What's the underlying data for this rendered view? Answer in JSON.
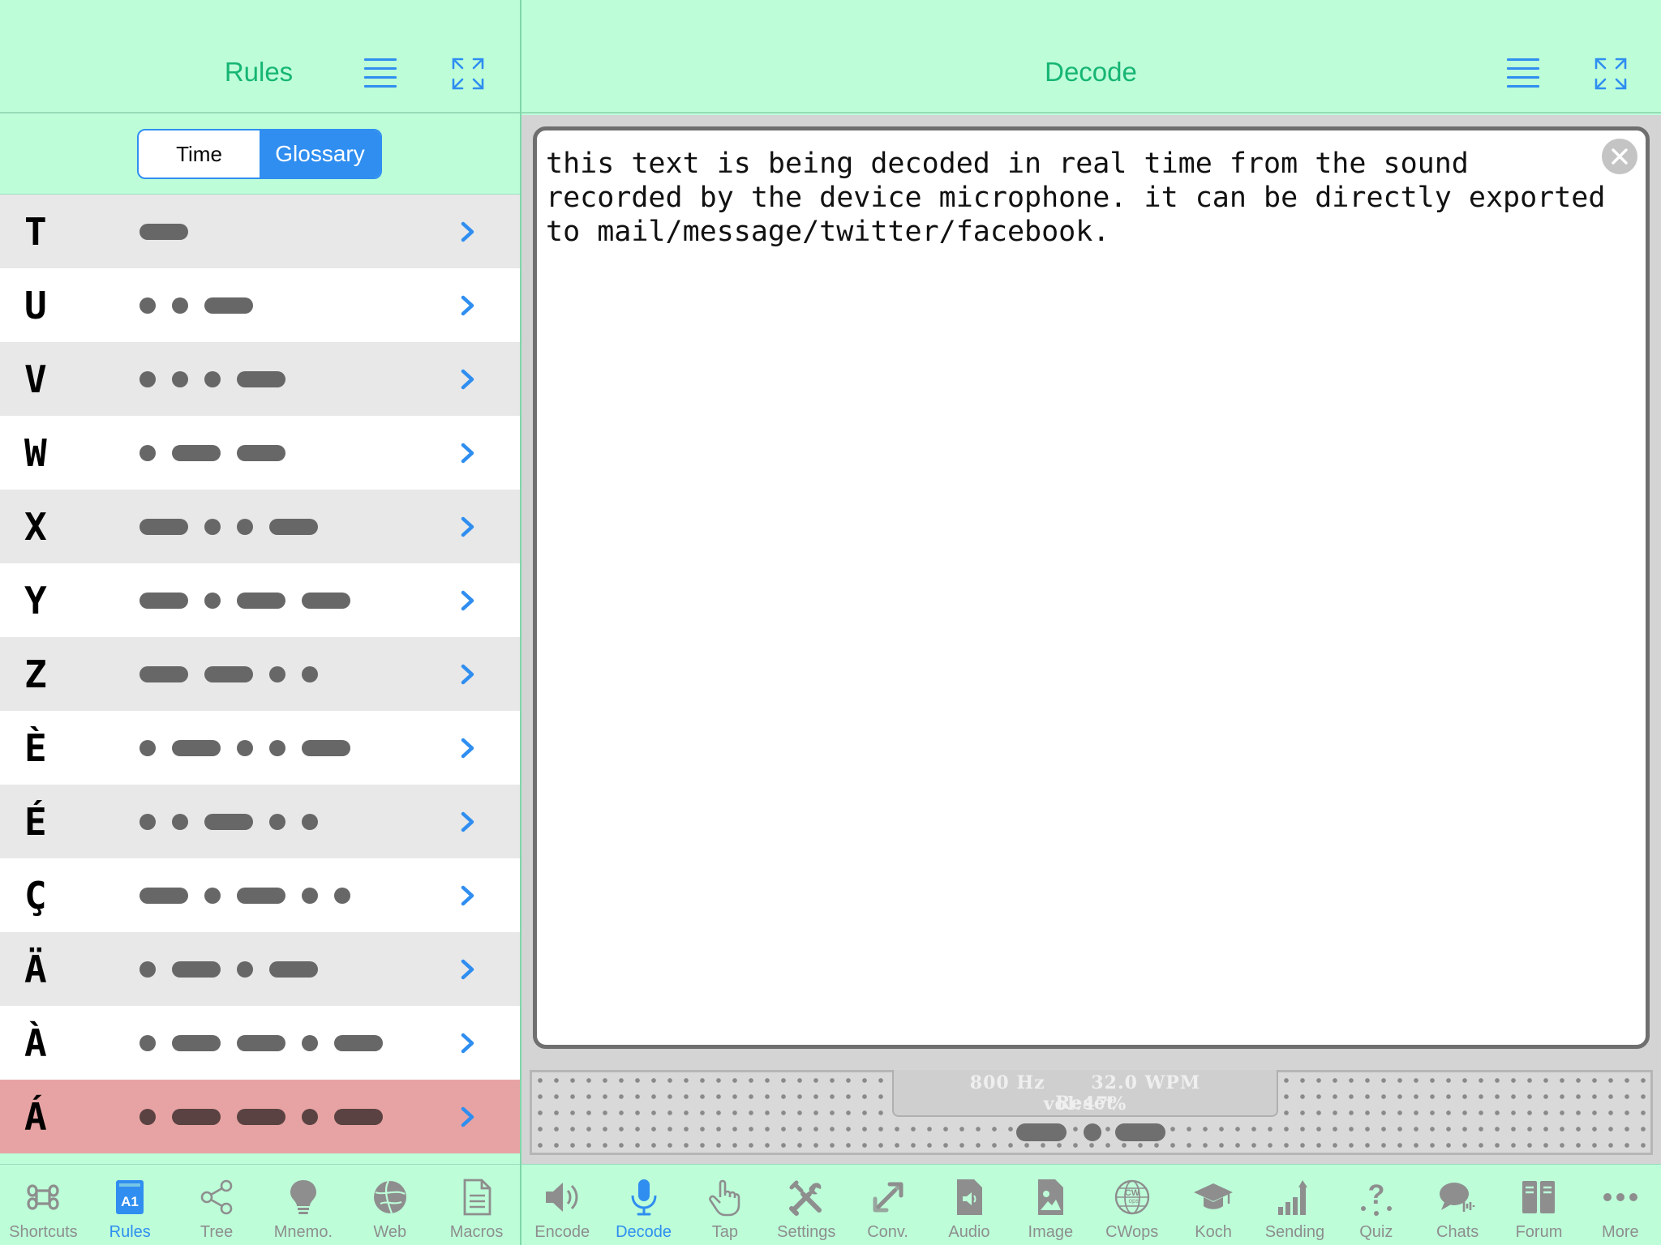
{
  "left_pane": {
    "title": "Rules",
    "segment": {
      "options": [
        "Time",
        "Glossary"
      ],
      "selected": "Glossary"
    },
    "rows": [
      {
        "letter": "T",
        "code": "-"
      },
      {
        "letter": "U",
        "code": "..-"
      },
      {
        "letter": "V",
        "code": "...-"
      },
      {
        "letter": "W",
        "code": ".--"
      },
      {
        "letter": "X",
        "code": "-..-"
      },
      {
        "letter": "Y",
        "code": "-.--"
      },
      {
        "letter": "Z",
        "code": "--.."
      },
      {
        "letter": "È",
        "code": ".-..-"
      },
      {
        "letter": "É",
        "code": "..-.."
      },
      {
        "letter": "Ç",
        "code": "-.-.."
      },
      {
        "letter": "Ä",
        "code": ".-.-"
      },
      {
        "letter": "À",
        "code": ".--.-"
      },
      {
        "letter": "Á",
        "code": ".--.-"
      }
    ],
    "highlighted_row": "Á",
    "tabs": [
      {
        "label": "Shortcuts",
        "icon": "command-icon"
      },
      {
        "label": "Rules",
        "icon": "a1-book-icon",
        "selected": true
      },
      {
        "label": "Tree",
        "icon": "share-tree-icon"
      },
      {
        "label": "Mnemo.",
        "icon": "lightbulb-icon"
      },
      {
        "label": "Web",
        "icon": "globe-icon"
      },
      {
        "label": "Macros",
        "icon": "document-icon"
      }
    ]
  },
  "right_pane": {
    "title": "Decode",
    "decoded_text": "this text is being decoded in real time from the sound\nrecorded by the device microphone. it can be directly exported\nto mail/message/twitter/facebook.",
    "readout": {
      "frequency": "800 Hz",
      "speed": "32.0 WPM",
      "volume": "vol:47%",
      "reset_label": "Reset"
    },
    "signal_code": "-.-",
    "tabs": [
      {
        "label": "Encode",
        "icon": "speaker-icon"
      },
      {
        "label": "Decode",
        "icon": "microphone-icon",
        "selected": true
      },
      {
        "label": "Tap",
        "icon": "hand-pointer-icon"
      },
      {
        "label": "Settings",
        "icon": "tools-icon"
      },
      {
        "label": "Conv.",
        "icon": "convert-arrows-icon"
      },
      {
        "label": "Audio",
        "icon": "audio-file-icon"
      },
      {
        "label": "Image",
        "icon": "image-file-icon"
      },
      {
        "label": "CWops",
        "icon": "cwops-globe-icon"
      },
      {
        "label": "Koch",
        "icon": "graduation-cap-icon"
      },
      {
        "label": "Sending",
        "icon": "bar-chart-icon"
      },
      {
        "label": "Quiz",
        "icon": "question-icon"
      },
      {
        "label": "Chats",
        "icon": "chat-bubbles-icon"
      },
      {
        "label": "Forum",
        "icon": "forum-icon"
      },
      {
        "label": "More",
        "icon": "ellipsis-icon"
      }
    ]
  },
  "colors": {
    "nav_background": "#bdfed9",
    "title_green": "#16b573",
    "accent_blue": "#2f8ef0",
    "highlight_row": "#e7a3a3",
    "tab_inactive": "#8e8e8e"
  }
}
